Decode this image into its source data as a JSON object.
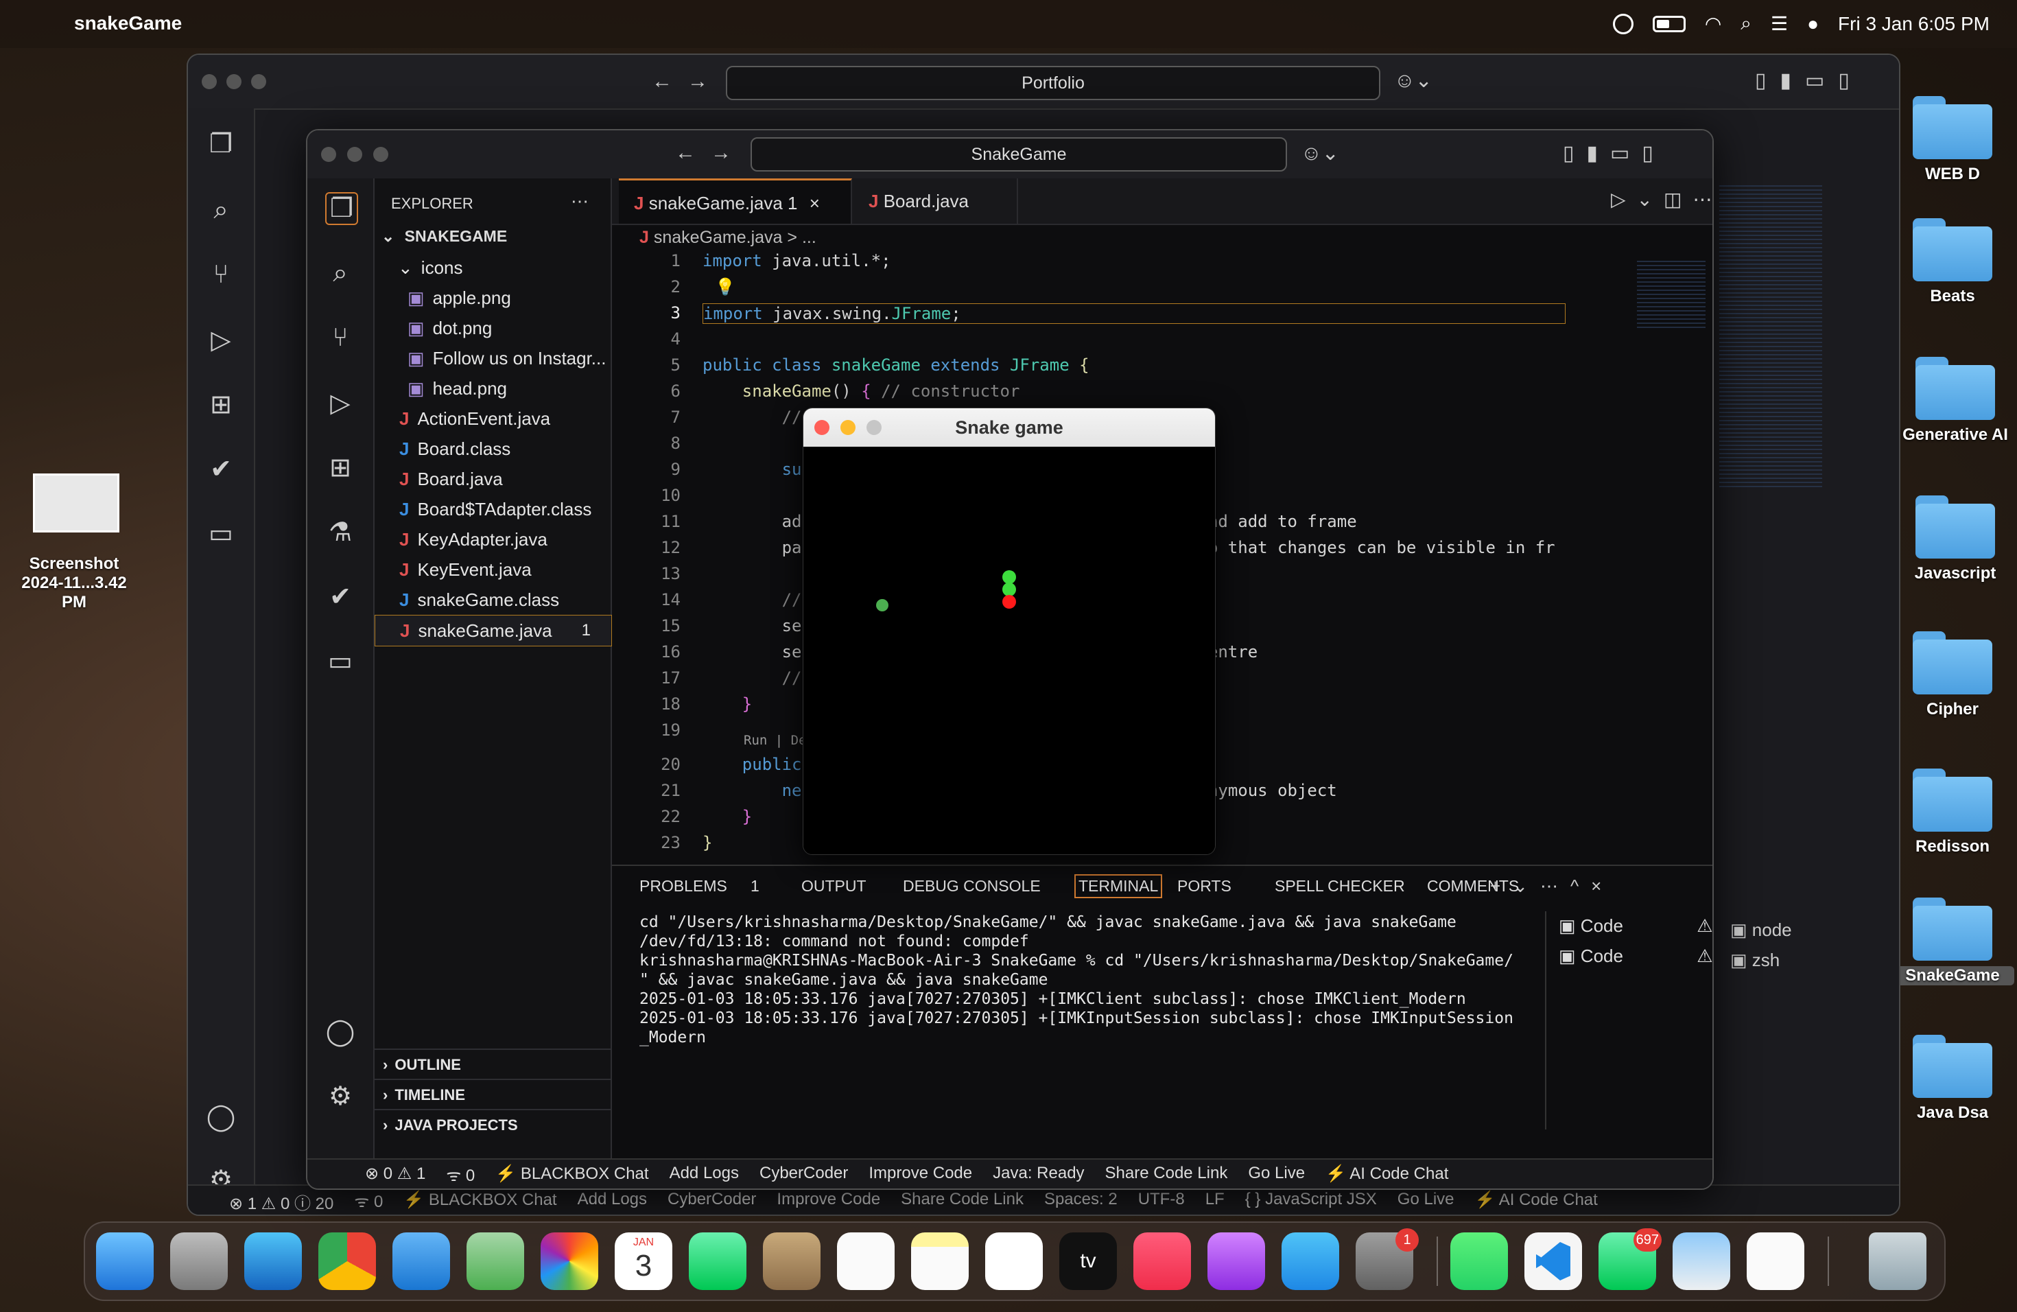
{
  "menubar": {
    "app": "snakeGame",
    "clock": "Fri 3 Jan  6:05 PM"
  },
  "desktop": {
    "screenshot_label_1": "Screenshot",
    "screenshot_label_2": "2024-11...3.42 PM",
    "folders": [
      "WEB D",
      "Beats",
      "Generative AI",
      "Javascript",
      "Cipher",
      "Redisson",
      "SnakeGame",
      "Java Dsa"
    ]
  },
  "backwin": {
    "search": "Portfolio",
    "status": [
      "⊗ 1 ⚠ 0 ⓘ 20",
      "ᯤ 0",
      "⚡ BLACKBOX Chat",
      "Add Logs",
      "CyberCoder",
      "Improve Code",
      "Share Code Link",
      "Spaces: 2",
      "UTF-8",
      "LF",
      "{ } JavaScript JSX",
      "Go Live",
      "⚡ AI Code Chat"
    ],
    "terminal_items": [
      "node",
      "zsh"
    ]
  },
  "frontwin": {
    "search": "SnakeGame",
    "explorer_title": "EXPLORER",
    "root": "SNAKEGAME",
    "tree": [
      {
        "label": "icons",
        "kind": "folder"
      },
      {
        "label": "apple.png",
        "kind": "img"
      },
      {
        "label": "dot.png",
        "kind": "img"
      },
      {
        "label": "Follow us on Instagr...",
        "kind": "img"
      },
      {
        "label": "head.png",
        "kind": "img"
      },
      {
        "label": "ActionEvent.java",
        "kind": "java"
      },
      {
        "label": "Board.class",
        "kind": "class"
      },
      {
        "label": "Board.java",
        "kind": "java"
      },
      {
        "label": "Board$TAdapter.class",
        "kind": "class"
      },
      {
        "label": "KeyAdapter.java",
        "kind": "java"
      },
      {
        "label": "KeyEvent.java",
        "kind": "java"
      },
      {
        "label": "snakeGame.class",
        "kind": "class"
      },
      {
        "label": "snakeGame.java",
        "kind": "java",
        "badge": "1"
      }
    ],
    "sections": [
      "OUTLINE",
      "TIMELINE",
      "JAVA PROJECTS"
    ],
    "tabs": [
      {
        "label": "snakeGame.java",
        "badge": "1"
      },
      {
        "label": "Board.java"
      }
    ],
    "breadcrumb": "snakeGame.java > ...",
    "code_lines": [
      "1",
      "2",
      "3",
      "4",
      "5",
      "6",
      "7",
      "8",
      "9",
      "10",
      "11",
      "12",
      "13",
      "14",
      "15",
      "16",
      "17",
      "18",
      "19",
      "20",
      "21",
      "22",
      "23"
    ],
    "codelens": "Run | Deb",
    "panel_tabs": [
      "PROBLEMS",
      "1",
      "OUTPUT",
      "DEBUG CONSOLE",
      "TERMINAL",
      "PORTS",
      "SPELL CHECKER",
      "COMMENTS"
    ],
    "terminal": [
      "cd \"/Users/krishnasharma/Desktop/SnakeGame/\" && javac snakeGame.java && java snakeGame",
      "/dev/fd/13:18: command not found: compdef",
      "krishnasharma@KRISHNAs-MacBook-Air-3 SnakeGame % cd \"/Users/krishnasharma/Desktop/SnakeGame/",
      "\" && javac snakeGame.java && java snakeGame",
      "2025-01-03 18:05:33.176 java[7027:270305] +[IMKClient subclass]: chose IMKClient_Modern",
      "2025-01-03 18:05:33.176 java[7027:270305] +[IMKInputSession subclass]: chose IMKInputSession",
      "_Modern"
    ],
    "terminal_items": [
      "Code",
      "Code"
    ],
    "status": [
      "⊗ 0 ⚠ 1",
      "ᯤ 0",
      "⚡ BLACKBOX Chat",
      "Add Logs",
      "CyberCoder",
      "Improve Code",
      "Java: Ready",
      "Share Code Link",
      "Go Live",
      "⚡ AI Code Chat"
    ]
  },
  "snake_game": {
    "title": "Snake game"
  },
  "dock": {
    "calendar_month": "JAN",
    "calendar_day": "3",
    "settings_badge": "1",
    "messages_badge": "697"
  }
}
